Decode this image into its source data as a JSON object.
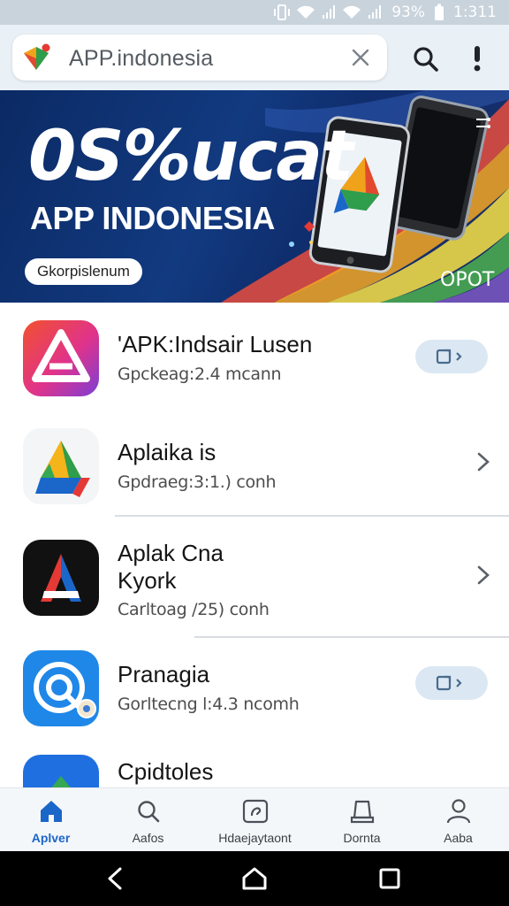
{
  "status_bar": {
    "battery": "93%",
    "time": "1:311"
  },
  "search": {
    "value": "APP.indonesia",
    "logo_icon": "app-indonesia-logo",
    "clear_icon": "close-icon",
    "search_icon": "search-icon",
    "more_icon": "more-vertical-icon"
  },
  "banner": {
    "title": "0S%ucat",
    "subtitle": "APP INDONESIA",
    "pill": "Gkorpislenum",
    "corner_text": "OPOT"
  },
  "apps": [
    {
      "name": "'APK:Indsair Lusen",
      "meta": "Gpckeag:2.4 mcann",
      "action": "open-button"
    },
    {
      "name": "Aplaika is",
      "meta": "Gpdraeg:3:1.) conh",
      "action": "chevron"
    },
    {
      "name_lines": [
        "Aplak Cna",
        "Kyork"
      ],
      "meta": "Carltoag /25) conh",
      "action": "chevron"
    },
    {
      "name": "Pranagia",
      "meta": "Gorltecng l:4.3 ncomh",
      "action": "open-button"
    },
    {
      "name": "Cpidtoles",
      "meta": "",
      "action": "none"
    }
  ],
  "bottom_nav": [
    {
      "label": "Aplver",
      "icon": "home-icon",
      "active": true
    },
    {
      "label": "Aafos",
      "icon": "search-icon",
      "active": false
    },
    {
      "label": "Hdaejaytaont",
      "icon": "updates-icon",
      "active": false
    },
    {
      "label": "Dornta",
      "icon": "library-icon",
      "active": false
    },
    {
      "label": "Aaba",
      "icon": "profile-icon",
      "active": false
    }
  ],
  "colors": {
    "accent": "#1b66c9",
    "banner_bg": "#0f2e6e",
    "button_bg": "#dbe8f3"
  }
}
